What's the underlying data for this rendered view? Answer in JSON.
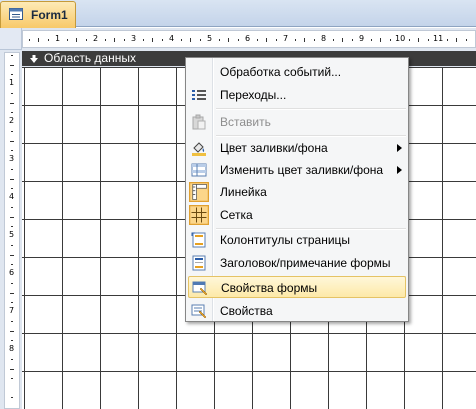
{
  "tab": {
    "title": "Form1",
    "icon": "form-icon"
  },
  "section": {
    "title": "Область данных",
    "icon": "section-arrow-icon"
  },
  "ruler": {
    "horizontal_numbers": [
      "1",
      "2",
      "3",
      "4",
      "5",
      "6",
      "7",
      "8",
      "9",
      "10",
      "11"
    ],
    "vertical_numbers": [
      "1",
      "2",
      "3",
      "4",
      "5",
      "6",
      "7",
      "8"
    ]
  },
  "context_menu": {
    "items": [
      {
        "label": "Обработка событий...",
        "icon": "",
        "enabled": true
      },
      {
        "label": "Переходы...",
        "icon": "tab-order-icon",
        "enabled": true
      },
      {
        "label": "Вставить",
        "icon": "paste-icon",
        "enabled": false
      },
      {
        "label": "Цвет заливки/фона",
        "icon": "fill-color-icon",
        "enabled": true,
        "submenu": true
      },
      {
        "label": "Изменить цвет заливки/фона",
        "icon": "alternate-fill-icon",
        "enabled": true,
        "submenu": true
      },
      {
        "label": "Линейка",
        "icon": "ruler-icon",
        "enabled": true,
        "checked": true
      },
      {
        "label": "Сетка",
        "icon": "grid-icon",
        "enabled": true,
        "checked": true
      },
      {
        "label": "Колонтитулы страницы",
        "icon": "page-header-footer-icon",
        "enabled": true
      },
      {
        "label": "Заголовок/примечание формы",
        "icon": "form-header-footer-icon",
        "enabled": true
      },
      {
        "label": "Свойства формы",
        "icon": "form-properties-icon",
        "enabled": true,
        "highlighted": true
      },
      {
        "label": "Свойства",
        "icon": "properties-icon",
        "enabled": true
      }
    ]
  },
  "colors": {
    "section_bar": "#3c3c3c",
    "highlight": "#fde9a8",
    "active_tab": "#f8c969"
  }
}
